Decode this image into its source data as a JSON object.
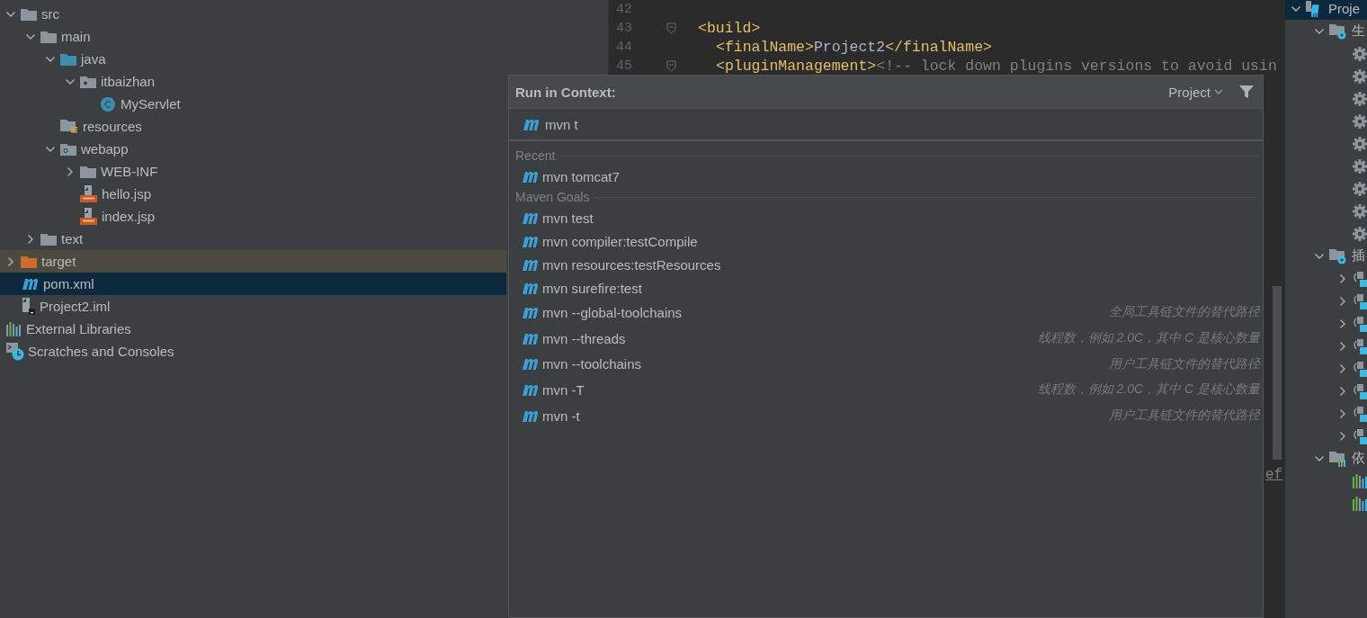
{
  "project_tree": [
    {
      "name": "src",
      "kind": "folder",
      "expanded": true,
      "selected": false,
      "children": [
        {
          "name": "main",
          "kind": "folder",
          "expanded": true,
          "selected": false,
          "children": [
            {
              "name": "java",
              "kind": "source-folder",
              "expanded": true,
              "selected": false,
              "children": [
                {
                  "name": "itbaizhan",
                  "kind": "package",
                  "expanded": true,
                  "selected": false,
                  "children": [
                    {
                      "name": "MyServlet",
                      "kind": "class",
                      "selected": false
                    }
                  ]
                }
              ]
            },
            {
              "name": "resources",
              "kind": "resources-folder",
              "selected": false
            },
            {
              "name": "webapp",
              "kind": "web-folder",
              "expanded": true,
              "selected": false,
              "children": [
                {
                  "name": "WEB-INF",
                  "kind": "folder",
                  "expanded": false,
                  "selected": false
                },
                {
                  "name": "hello.jsp",
                  "kind": "jsp-file",
                  "selected": false
                },
                {
                  "name": "index.jsp",
                  "kind": "jsp-file",
                  "selected": false
                }
              ]
            }
          ]
        },
        {
          "name": "text",
          "kind": "folder",
          "expanded": false,
          "selected": false
        }
      ]
    },
    {
      "name": "target",
      "kind": "excluded-folder",
      "expanded": false,
      "selected": false
    },
    {
      "name": "pom.xml",
      "kind": "maven-file",
      "selected": true
    },
    {
      "name": "Project2.iml",
      "kind": "module-file",
      "selected": false
    }
  ],
  "project_roots": [
    {
      "name": "External Libraries",
      "kind": "libraries",
      "selected": false
    },
    {
      "name": "Scratches and Consoles",
      "kind": "scratches",
      "selected": false
    }
  ],
  "editor": {
    "lines": [
      {
        "number": "42",
        "fold": false
      },
      {
        "number": "43",
        "fold": true,
        "tokens": [
          {
            "kind": "tag",
            "text": "<build>"
          }
        ]
      },
      {
        "number": "44",
        "fold": false,
        "indent": true,
        "tokens": [
          {
            "kind": "tag",
            "text": "<finalName>"
          },
          {
            "kind": "text",
            "text": "Project2"
          },
          {
            "kind": "tag",
            "text": "</finalName>"
          }
        ]
      },
      {
        "number": "45",
        "fold": true,
        "indent": true,
        "tokens": [
          {
            "kind": "tag",
            "text": "<pluginManagement>"
          },
          {
            "kind": "comment",
            "text": "<!-- lock down plugins versions to avoid usin"
          }
        ]
      }
    ],
    "fragment": "ef"
  },
  "popup": {
    "title": "Run in Context:",
    "scope": "Project",
    "query": "mvn t",
    "sections": [
      {
        "title": "Recent",
        "items": [
          {
            "label": "mvn tomcat7",
            "selected": false
          }
        ]
      },
      {
        "title": "Maven Goals",
        "items": [
          {
            "label": "mvn test",
            "selected": false
          },
          {
            "label": "mvn compiler:testCompile",
            "selected": false
          },
          {
            "label": "mvn resources:testResources",
            "selected": false
          },
          {
            "label": "mvn surefire:test",
            "selected": false
          },
          {
            "label": "mvn --global-toolchains",
            "hint": "全局工具链文件的替代路径",
            "selected": false
          },
          {
            "label": "mvn --threads",
            "hint": "线程数，例如 2.0C，其中 C 是核心数量",
            "selected": false
          },
          {
            "label": "mvn --toolchains",
            "hint": "用户工具链文件的替代路径",
            "selected": false
          },
          {
            "label": "mvn -T",
            "hint": "线程数，例如 2.0C，其中 C 是核心数量",
            "selected": false
          },
          {
            "label": "mvn -t",
            "hint": "用户工具链文件的替代路径",
            "selected": false
          }
        ]
      }
    ]
  },
  "maven_tree": [
    {
      "name": "Proje",
      "kind": "project",
      "expanded": true,
      "selected": true,
      "children": [
        {
          "name": "生",
          "kind": "lifecycle-folder",
          "expanded": true,
          "selected": false,
          "children": [
            {
              "kind": "goal",
              "selected": false
            },
            {
              "kind": "goal",
              "selected": false
            },
            {
              "kind": "goal",
              "selected": false
            },
            {
              "kind": "goal",
              "selected": false
            },
            {
              "kind": "goal",
              "selected": false
            },
            {
              "kind": "goal",
              "selected": false
            },
            {
              "kind": "goal",
              "selected": false
            },
            {
              "kind": "goal",
              "selected": false
            },
            {
              "kind": "goal",
              "selected": false
            }
          ]
        },
        {
          "name": "插",
          "kind": "plugins-folder",
          "expanded": true,
          "selected": false,
          "children": [
            {
              "kind": "plugin",
              "expanded": false,
              "selected": false
            },
            {
              "kind": "plugin",
              "expanded": false,
              "selected": false
            },
            {
              "kind": "plugin",
              "expanded": false,
              "selected": false
            },
            {
              "kind": "plugin",
              "expanded": false,
              "selected": false
            },
            {
              "kind": "plugin",
              "expanded": false,
              "selected": false
            },
            {
              "kind": "plugin",
              "expanded": false,
              "selected": false
            },
            {
              "kind": "plugin",
              "expanded": false,
              "selected": false
            },
            {
              "kind": "plugin",
              "expanded": false,
              "selected": false
            }
          ]
        },
        {
          "name": "依",
          "kind": "dependencies-folder",
          "expanded": true,
          "selected": false,
          "children": [
            {
              "kind": "library",
              "selected": false
            },
            {
              "kind": "library",
              "selected": false
            }
          ]
        }
      ]
    }
  ]
}
